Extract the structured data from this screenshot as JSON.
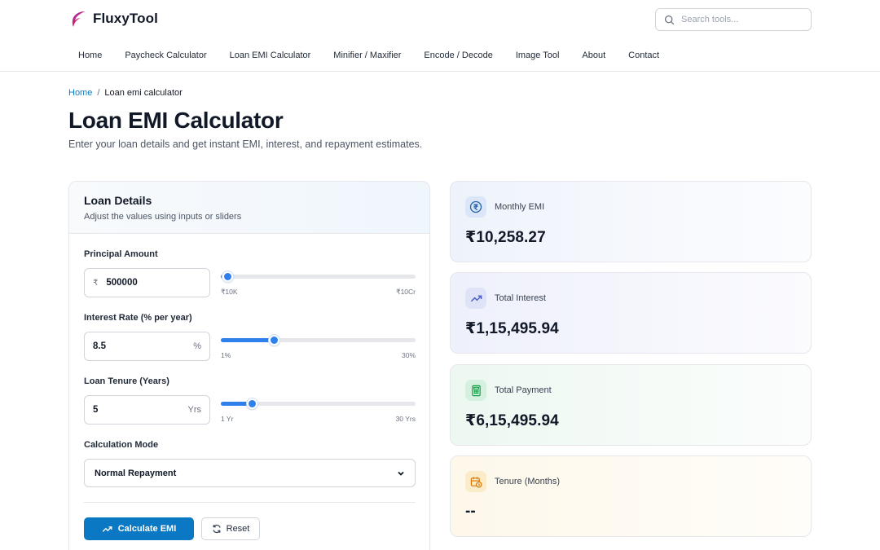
{
  "brand": {
    "name": "FluxyTool"
  },
  "search": {
    "placeholder": "Search tools..."
  },
  "nav": [
    {
      "label": "Home"
    },
    {
      "label": "Paycheck Calculator"
    },
    {
      "label": "Loan EMI Calculator"
    },
    {
      "label": "Minifier / Maxifier"
    },
    {
      "label": "Encode / Decode"
    },
    {
      "label": "Image Tool"
    },
    {
      "label": "About"
    },
    {
      "label": "Contact"
    }
  ],
  "breadcrumb": {
    "home": "Home",
    "sep": "/",
    "current": "Loan emi calculator"
  },
  "page": {
    "title": "Loan EMI Calculator",
    "subtitle": "Enter your loan details and get instant EMI, interest, and repayment estimates."
  },
  "form": {
    "title": "Loan Details",
    "subtitle": "Adjust the values using inputs or sliders",
    "principal": {
      "label": "Principal Amount",
      "prefix": "₹",
      "value": "500000",
      "min_label": "₹10K",
      "max_label": "₹10Cr",
      "slider_fraction": 0.035
    },
    "rate": {
      "label": "Interest Rate (% per year)",
      "value": "8.5",
      "suffix": "%",
      "min_label": "1%",
      "max_label": "30%",
      "slider_fraction": 0.27
    },
    "tenure": {
      "label": "Loan Tenure (Years)",
      "value": "5",
      "suffix": "Yrs",
      "min_label": "1 Yr",
      "max_label": "30 Yrs",
      "slider_fraction": 0.16
    },
    "mode": {
      "label": "Calculation Mode",
      "selected": "Normal Repayment"
    },
    "calculate_label": "Calculate EMI",
    "reset_label": "Reset"
  },
  "results": {
    "monthly_emi": {
      "label": "Monthly EMI",
      "value": "₹10,258.27",
      "icon": "rupee-icon"
    },
    "total_interest": {
      "label": "Total Interest",
      "value": "₹1,15,495.94",
      "icon": "trend-up-icon"
    },
    "total_payment": {
      "label": "Total Payment",
      "value": "₹6,15,495.94",
      "icon": "calculator-icon"
    },
    "tenure_months": {
      "label": "Tenure (Months)",
      "value": "--",
      "icon": "calendar-clock-icon"
    }
  },
  "colors": {
    "primary": "#0a78c2",
    "slider": "#2f80ed",
    "link": "#0e7bbd",
    "emi_bg": "#eef3fb",
    "interest_bg": "#eef0fb",
    "payment_bg": "#edf8f1",
    "tenure_bg": "#fdf8ea"
  }
}
